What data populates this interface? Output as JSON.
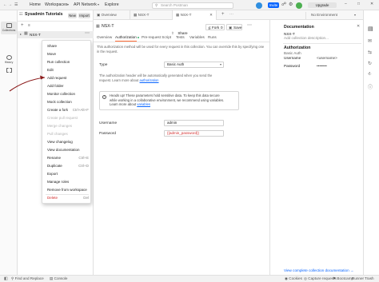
{
  "topbar": {
    "nav": [
      "Home",
      "Workspaces",
      "API Network",
      "Explore"
    ],
    "search_placeholder": "Search Postman",
    "invite_label": "Invite",
    "upgrade_label": "Upgrade"
  },
  "rail": {
    "items": [
      {
        "label": "Collections",
        "icon": "collections-icon"
      },
      {
        "label": "History",
        "icon": "history-icon"
      },
      {
        "label": "",
        "icon": "apps-icon"
      }
    ]
  },
  "sidebar": {
    "workspace_name": "Sysadmin Tutorials",
    "new_label": "New",
    "import_label": "Import",
    "collection_name": "NSX-T"
  },
  "context_menu": {
    "items": [
      {
        "label": "Share",
        "shortcut": "",
        "state": "normal"
      },
      {
        "label": "Move",
        "shortcut": "",
        "state": "normal"
      },
      {
        "label": "Run collection",
        "shortcut": "",
        "state": "normal"
      },
      {
        "label": "Edit",
        "shortcut": "",
        "state": "normal"
      },
      {
        "label": "Add request",
        "shortcut": "",
        "state": "normal"
      },
      {
        "label": "Add folder",
        "shortcut": "",
        "state": "normal"
      },
      {
        "label": "Monitor collection",
        "shortcut": "",
        "state": "normal"
      },
      {
        "label": "Mock collection",
        "shortcut": "",
        "state": "normal"
      },
      {
        "label": "Create a fork",
        "shortcut": "Ctrl+Alt+F",
        "state": "normal"
      },
      {
        "label": "Create pull request",
        "shortcut": "",
        "state": "disabled"
      },
      {
        "label": "Merge changes",
        "shortcut": "",
        "state": "disabled"
      },
      {
        "label": "Pull changes",
        "shortcut": "",
        "state": "disabled"
      },
      {
        "label": "View changelog",
        "shortcut": "",
        "state": "normal"
      },
      {
        "label": "View documentation",
        "shortcut": "",
        "state": "normal"
      },
      {
        "label": "Rename",
        "shortcut": "Ctrl+E",
        "state": "normal"
      },
      {
        "label": "Duplicate",
        "shortcut": "Ctrl+D",
        "state": "normal"
      },
      {
        "label": "Export",
        "shortcut": "",
        "state": "normal"
      },
      {
        "label": "Manage roles",
        "shortcut": "",
        "state": "normal"
      },
      {
        "label": "Remove from workspace",
        "shortcut": "",
        "state": "normal"
      },
      {
        "label": "Delete",
        "shortcut": "Del",
        "state": "danger"
      }
    ]
  },
  "tabs": [
    {
      "label": "Overview"
    },
    {
      "label": "NSX-T"
    },
    {
      "label": "NSX-T"
    }
  ],
  "env": {
    "label": "No Environment"
  },
  "main": {
    "breadcrumb": "NSX-T",
    "share_label": "Share",
    "fork_label": "Fork",
    "fork_count": "0",
    "save_label": "Save",
    "subtabs": [
      "Overview",
      "Authorization",
      "Pre-request Script",
      "Tests",
      "Variables",
      "Runs"
    ],
    "info_text_1": "This authorization method will be used for every request in this collection. You can override this by specifying one in the request.",
    "type_label": "Type",
    "type_value": "Basic Auth",
    "auth_desc_1": "The authorization header will be automatically generated when you send the",
    "auth_desc_2": "request. Learn more about",
    "auth_desc_link": "authorization",
    "warning_1": "Heads up! These parameters hold sensitive data. To keep this data secure",
    "warning_2": "while working in a collaborative environment, we recommend using variables.",
    "warning_3": "Learn more about",
    "warning_link": "variables",
    "username_label": "Username",
    "username_value": "admin",
    "password_label": "Password",
    "password_value": "{{admin_password}}"
  },
  "right_panel": {
    "title": "Documentation",
    "collection_name": "NSX-T",
    "add_description": "Add collection description...",
    "auth_heading": "Authorization",
    "auth_type": "Basic Auth",
    "username_label": "Username",
    "username_value": "<username>",
    "password_label": "Password",
    "password_value": "••••••••",
    "view_docs_link": "View complete collection documentation →"
  },
  "statusbar": {
    "left": [
      "Find and Replace",
      "Console"
    ],
    "right": [
      "Cookies",
      "Capture requests",
      "Bootcamp",
      "Runner",
      "Trash"
    ]
  },
  "colors": {
    "accent": "#ff6c37",
    "primary": "#0a66ff",
    "danger": "#d22b2b",
    "annotation_arrow": "#8b1a1a"
  }
}
